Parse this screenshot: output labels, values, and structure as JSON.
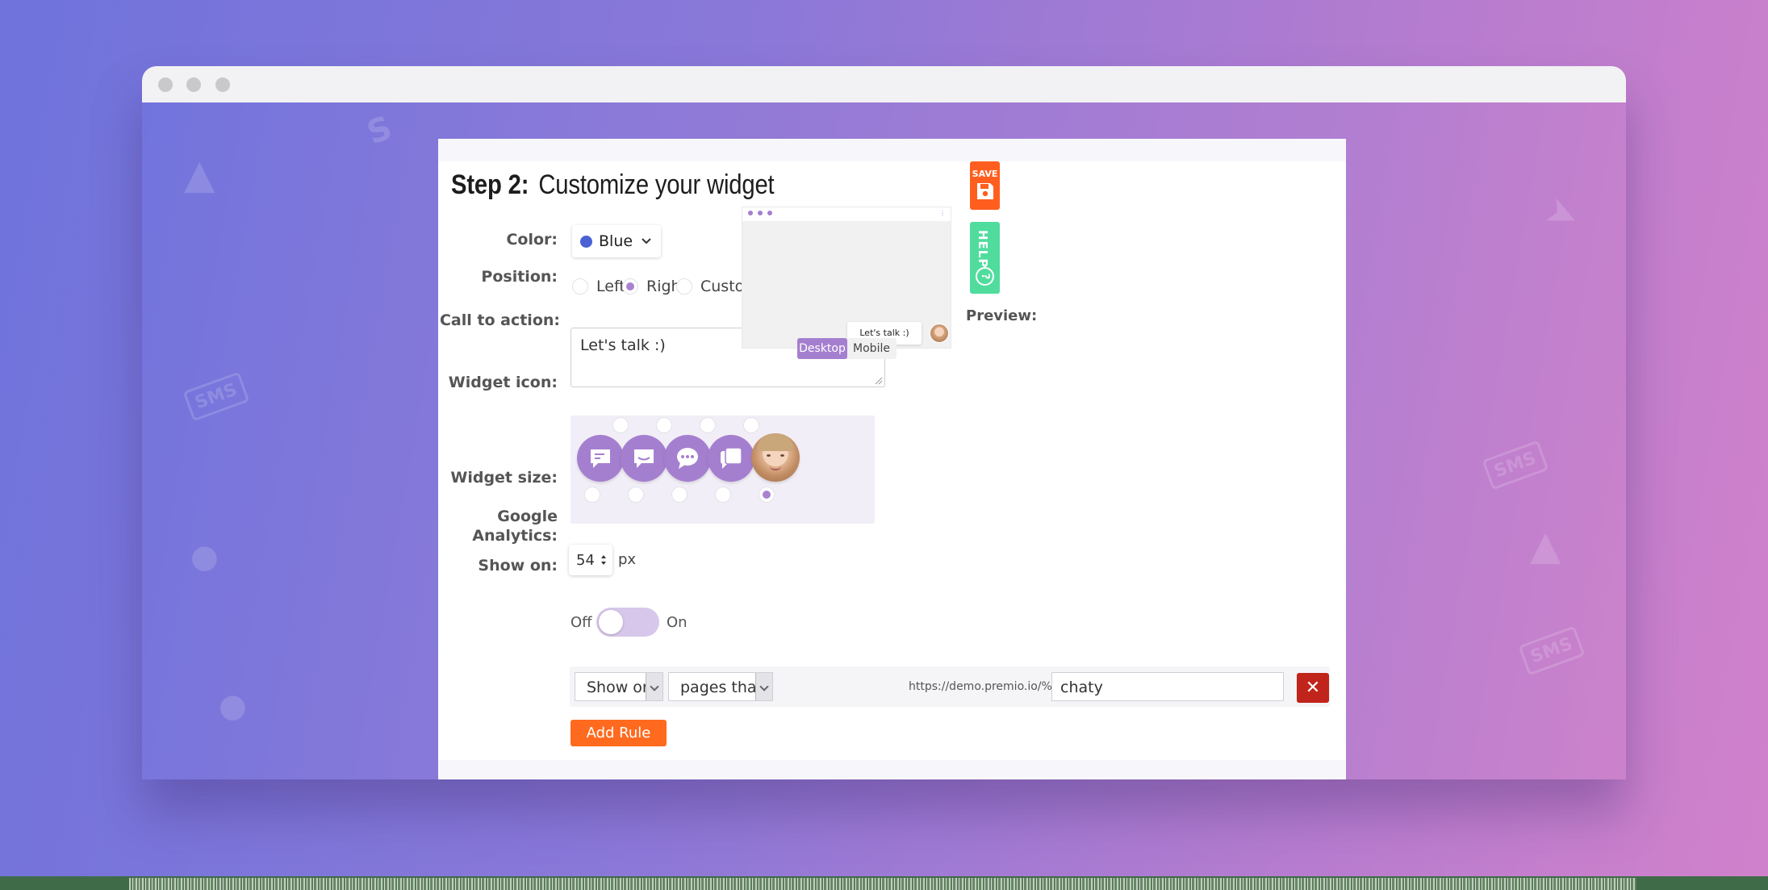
{
  "step": {
    "number_label": "Step 2:",
    "title": "Customize your widget"
  },
  "color": {
    "label": "Color:",
    "value": "Blue",
    "swatch": "#4a61d4"
  },
  "position": {
    "label": "Position:",
    "options": [
      "Left",
      "Right",
      "Custom"
    ],
    "selected": "Right"
  },
  "call_to_action": {
    "label": "Call to action:",
    "value": "Let's talk :)"
  },
  "widget_icon": {
    "label": "Widget icon:",
    "icons": [
      "chat-icon",
      "chat-smile-icon",
      "chat-dots-icon",
      "chat-stack-icon",
      "avatar"
    ],
    "selected_index": 4
  },
  "widget_size": {
    "label": "Widget size:",
    "value": "54",
    "unit": "px"
  },
  "google_analytics": {
    "label_line1": "Google",
    "label_line2": "Analytics:",
    "off": "Off",
    "on": "On",
    "enabled": false
  },
  "show_on": {
    "label": "Show on:",
    "rule_action": "Show on",
    "rule_condition": "pages that conta",
    "url_prefix": "https://demo.premio.io/%s%",
    "url_value": "chaty",
    "remove_symbol": "✕",
    "add_rule": "Add Rule"
  },
  "preview": {
    "label": "Preview:",
    "bubble_text": "Let's talk :)",
    "desktop": "Desktop",
    "mobile": "Mobile",
    "active": "Desktop"
  },
  "side_tabs": {
    "save": "SAVE",
    "help": "HELP",
    "help_symbol": "?"
  },
  "colors": {
    "accent": "#a57fcf",
    "save": "#ff5e1f",
    "help": "#4fdc9d",
    "add_rule": "#ff6a1f",
    "remove": "#c0241a"
  }
}
